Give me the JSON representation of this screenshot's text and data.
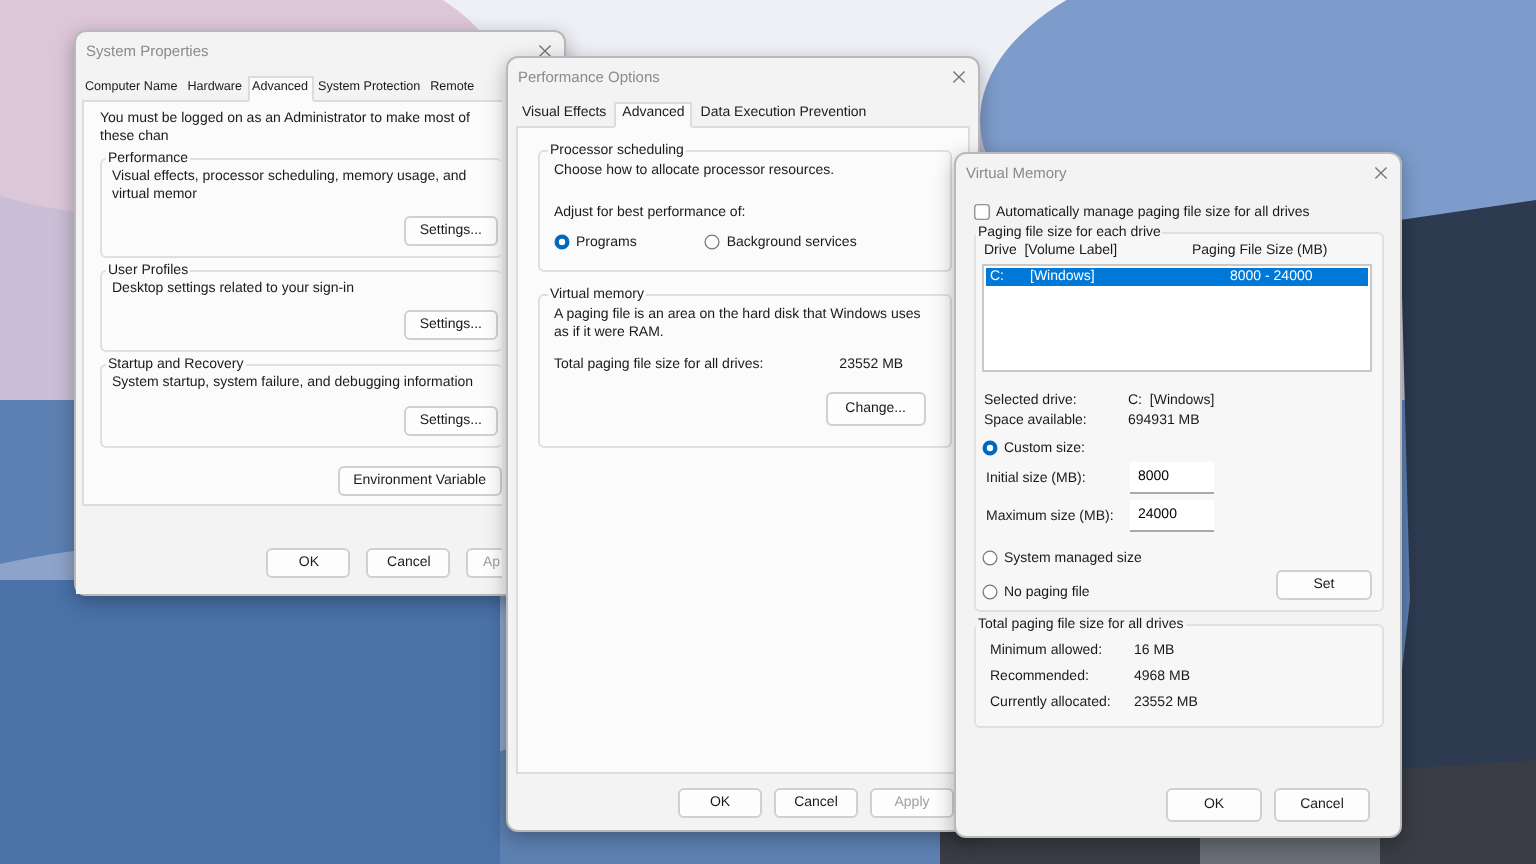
{
  "system_properties": {
    "title": "System Properties",
    "tabs": [
      {
        "label": "Computer Name",
        "selected": false
      },
      {
        "label": "Hardware",
        "selected": false
      },
      {
        "label": "Advanced",
        "selected": true
      },
      {
        "label": "System Protection",
        "selected": false
      },
      {
        "label": "Remote",
        "selected": false
      }
    ],
    "notice": "You must be logged on as an Administrator to make most of these chan",
    "groups": [
      {
        "title": "Performance",
        "description": "Visual effects, processor scheduling, memory usage, and virtual memor",
        "button": "Settings..."
      },
      {
        "title": "User Profiles",
        "description": "Desktop settings related to your sign-in",
        "button": "Settings..."
      },
      {
        "title": "Startup and Recovery",
        "description": "System startup, system failure, and debugging information",
        "button": "Settings..."
      }
    ],
    "env_button": "Environment Variable",
    "buttons": [
      {
        "label": "OK",
        "disabled": false
      },
      {
        "label": "Cancel",
        "disabled": false
      },
      {
        "label": "Ap",
        "disabled": true
      }
    ]
  },
  "performance_options": {
    "title": "Performance Options",
    "tabs": [
      {
        "label": "Visual Effects",
        "selected": false
      },
      {
        "label": "Advanced",
        "selected": true
      },
      {
        "label": "Data Execution Prevention",
        "selected": false
      }
    ],
    "processor_scheduling": {
      "title": "Processor scheduling",
      "description": "Choose how to allocate processor resources.",
      "adjust_label": "Adjust for best performance of:",
      "options": [
        {
          "label": "Programs",
          "selected": true
        },
        {
          "label": "Background services",
          "selected": false
        }
      ]
    },
    "virtual_memory": {
      "title": "Virtual memory",
      "description": "A paging file is an area on the hard disk that Windows uses as if it were RAM.",
      "total_label": "Total paging file size for all drives:",
      "total_value": "23552 MB",
      "button": "Change..."
    },
    "buttons": [
      {
        "label": "OK",
        "disabled": false
      },
      {
        "label": "Cancel",
        "disabled": false
      },
      {
        "label": "Apply",
        "disabled": true
      }
    ]
  },
  "virtual_memory": {
    "title": "Virtual Memory",
    "auto_manage": {
      "label": "Automatically manage paging file size for all drives",
      "checked": false
    },
    "group_title": "Paging file size for each drive",
    "columns": [
      "Drive  [Volume Label]",
      "Paging File Size (MB)"
    ],
    "drives": [
      {
        "drive": "C:",
        "label": "[Windows]",
        "size": "8000 - 24000",
        "selected": true
      }
    ],
    "info": [
      {
        "label": "Selected drive:",
        "value": "C:  [Windows]"
      },
      {
        "label": "Space available:",
        "value": "694931 MB"
      }
    ],
    "size_options": [
      {
        "label": "Custom size:",
        "selected": true
      },
      {
        "label": "System managed size",
        "selected": false
      },
      {
        "label": "No paging file",
        "selected": false
      }
    ],
    "fields": [
      {
        "label": "Initial size (MB):",
        "value": "8000"
      },
      {
        "label": "Maximum size (MB):",
        "value": "24000"
      }
    ],
    "set_button": "Set",
    "totals": {
      "title": "Total paging file size for all drives",
      "rows": [
        {
          "label": "Minimum allowed:",
          "value": "16 MB"
        },
        {
          "label": "Recommended:",
          "value": "4968 MB"
        },
        {
          "label": "Currently allocated:",
          "value": "23552 MB"
        }
      ]
    },
    "buttons": [
      "OK",
      "Cancel"
    ]
  }
}
